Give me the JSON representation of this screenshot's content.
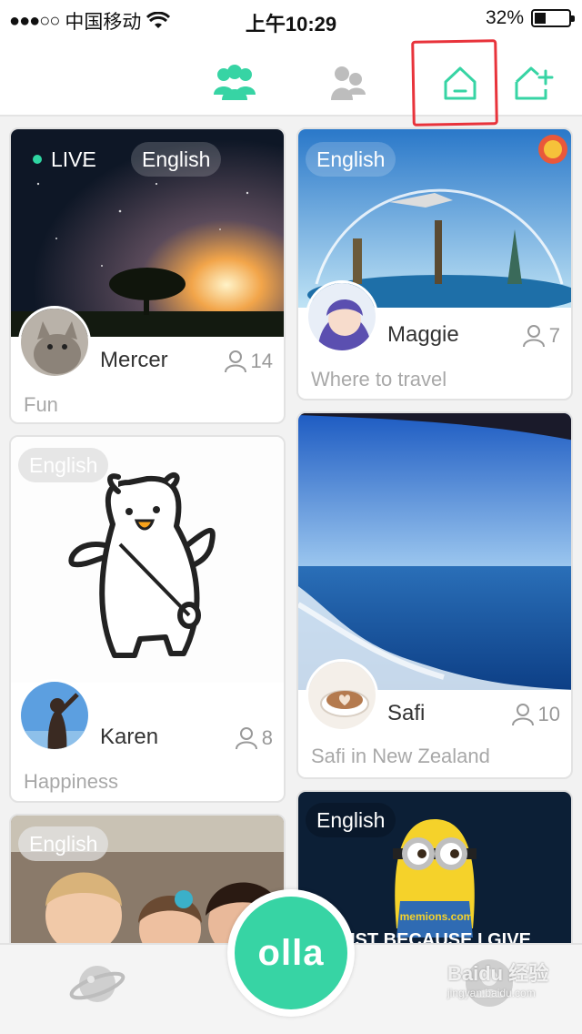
{
  "status_bar": {
    "carrier": "中国移动",
    "time": "上午10:29",
    "battery_text": "32%",
    "battery_level": 0.32
  },
  "top_nav": {
    "icons": [
      "groups-icon",
      "friends-icon",
      "home-icon",
      "add-home-icon"
    ],
    "accent_color": "#37d4a4",
    "highlighted": "home-icon"
  },
  "cards": [
    {
      "tag": "English",
      "live": "LIVE",
      "name": "Mercer",
      "count": "14",
      "desc": "Fun"
    },
    {
      "tag": "English",
      "name": "Maggie",
      "count": "7",
      "desc": "Where to travel"
    },
    {
      "tag": "English",
      "name": "Karen",
      "count": "8",
      "desc": "Happiness"
    },
    {
      "tag": "",
      "name": "Safi",
      "count": "10",
      "desc": "Safi in New Zealand"
    },
    {
      "tag": "English"
    },
    {
      "tag": "English",
      "poster_text": "UST BECAUSE I GIVE",
      "poster_brand": "memions.com"
    }
  ],
  "bottom_bar": {
    "center_button": "olla",
    "left_icon": "planet-icon",
    "right_icon": "profile-icon"
  },
  "watermark": {
    "text": "Baidu 经验",
    "sub": "jingyan.baidu.com"
  }
}
